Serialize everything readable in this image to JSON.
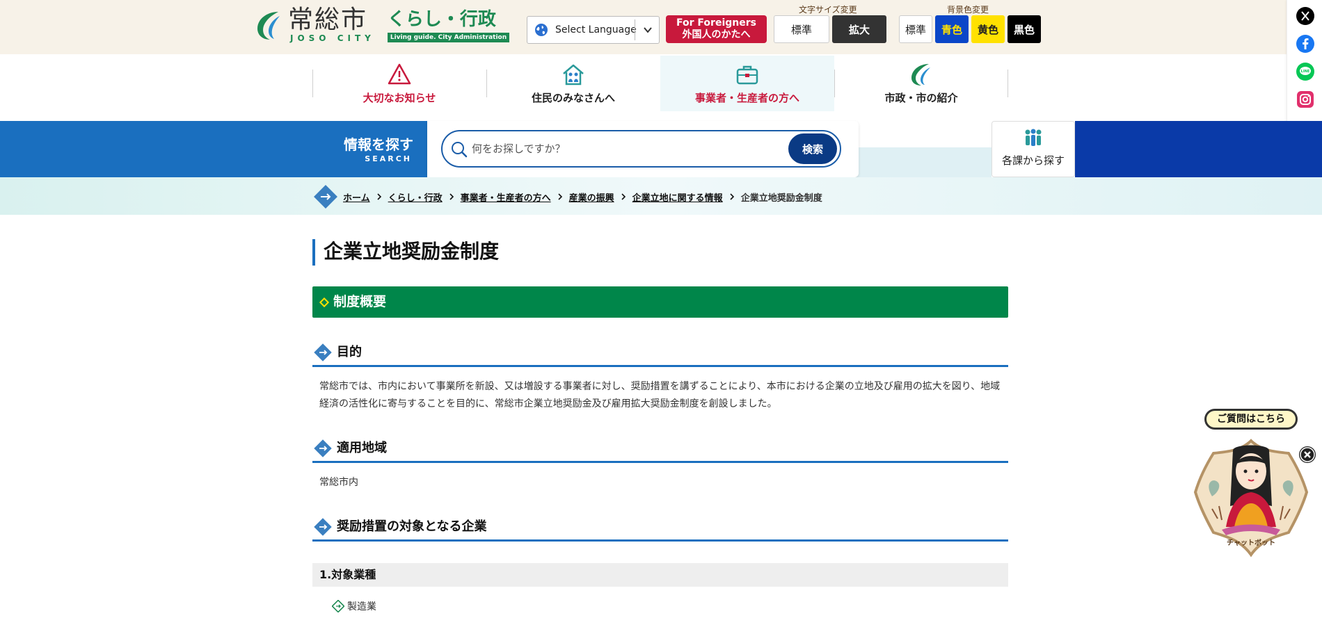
{
  "header": {
    "logo_name": "常総市",
    "logo_sub": "JOSO CITY",
    "category_main": "くらし・行政",
    "category_sub": "Living guide. City Administration",
    "language_label": "Select Language",
    "foreigners_line1": "For Foreigners",
    "foreigners_line2": "外国人のかたへ",
    "font_size_label": "文字サイズ変更",
    "font_size_standard": "標準",
    "font_size_large": "拡大",
    "bg_color_label": "背景色変更",
    "bg_standard": "標準",
    "bg_blue": "青色",
    "bg_yellow": "黄色",
    "bg_black": "黒色"
  },
  "social": [
    "x-icon",
    "facebook-icon",
    "line-icon",
    "instagram-icon",
    "youtube-icon",
    "note-icon"
  ],
  "nav": {
    "items": [
      {
        "label": "大切なお知らせ",
        "icon": "warning-icon",
        "color": "#c8193c"
      },
      {
        "label": "住民のみなさんへ",
        "icon": "home-people-icon",
        "color": "#222222"
      },
      {
        "label": "事業者・生産者の方へ",
        "icon": "briefcase-icon",
        "color": "#c8193c"
      },
      {
        "label": "市政・市の紹介",
        "icon": "city-leaf-icon",
        "color": "#222222"
      }
    ]
  },
  "search": {
    "title": "情報を探す",
    "subtitle": "SEARCH",
    "placeholder": "何をお探しですか？",
    "button": "検索",
    "dept_label": "各課から探す"
  },
  "breadcrumb": {
    "links": [
      "ホーム",
      "くらし・行政",
      "事業者・生産者の方へ",
      "産業の振興",
      "企業立地に関する情報"
    ],
    "current": "企業立地奨励金制度"
  },
  "content": {
    "title": "企業立地奨励金制度",
    "section": "制度概要",
    "h_purpose": "目的",
    "purpose_text": "常総市では、市内において事業所を新設、又は増設する事業者に対し、奨励措置を講ずることにより、本市における企業の立地及び雇用の拡大を図り、地域経済の活性化に寄与することを目的に、常総市企業立地奨励金及び雇用拡大奨励金制度を創設しました。",
    "h_area": "適用地域",
    "area_text": "常総市内",
    "h_target": "奨励措置の対象となる企業",
    "h4_industry": "1.対象業種",
    "industry_item": "製造業"
  },
  "chatbot": {
    "bubble": "ご質問はこちら",
    "label": "チャットボット"
  },
  "colors": {
    "brand_green": "#00864a",
    "brand_blue": "#1a6fbf",
    "alert_red": "#c8193c",
    "navy": "#0a3aa8"
  }
}
